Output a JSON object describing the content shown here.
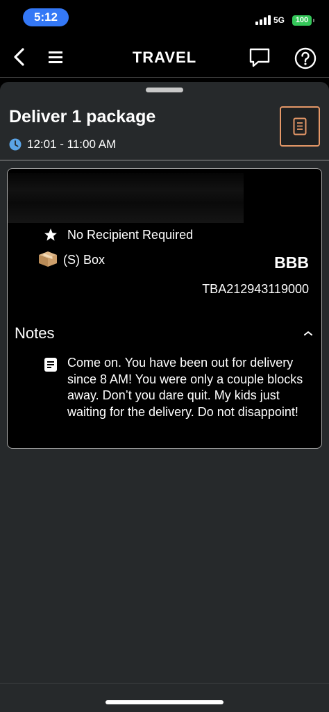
{
  "status_bar": {
    "time": "5:12",
    "network": "5G",
    "battery": "100",
    "colors": {
      "time_pill": "#3478f6",
      "battery": "#34c759"
    }
  },
  "header": {
    "title": "TRAVEL",
    "icons": {
      "back": "chevron-left-icon",
      "menu": "hamburger-icon",
      "chat": "chat-bubble-icon",
      "help": "question-icon"
    }
  },
  "task": {
    "title": "Deliver 1 package",
    "time_window": "12:01 - 11:00 AM",
    "accent_color": "#e59868"
  },
  "package": {
    "recipient_requirement": "No Recipient Required",
    "size_label": "(S) Box",
    "route_code": "BBB",
    "tracking_id": "TBA212943119000"
  },
  "notes": {
    "header": "Notes",
    "text": "Come on. You have been out for delivery since 8 AM! You were only a couple blocks away. Don’t you dare quit. My kids just waiting for the delivery. Do not disappoint!"
  }
}
